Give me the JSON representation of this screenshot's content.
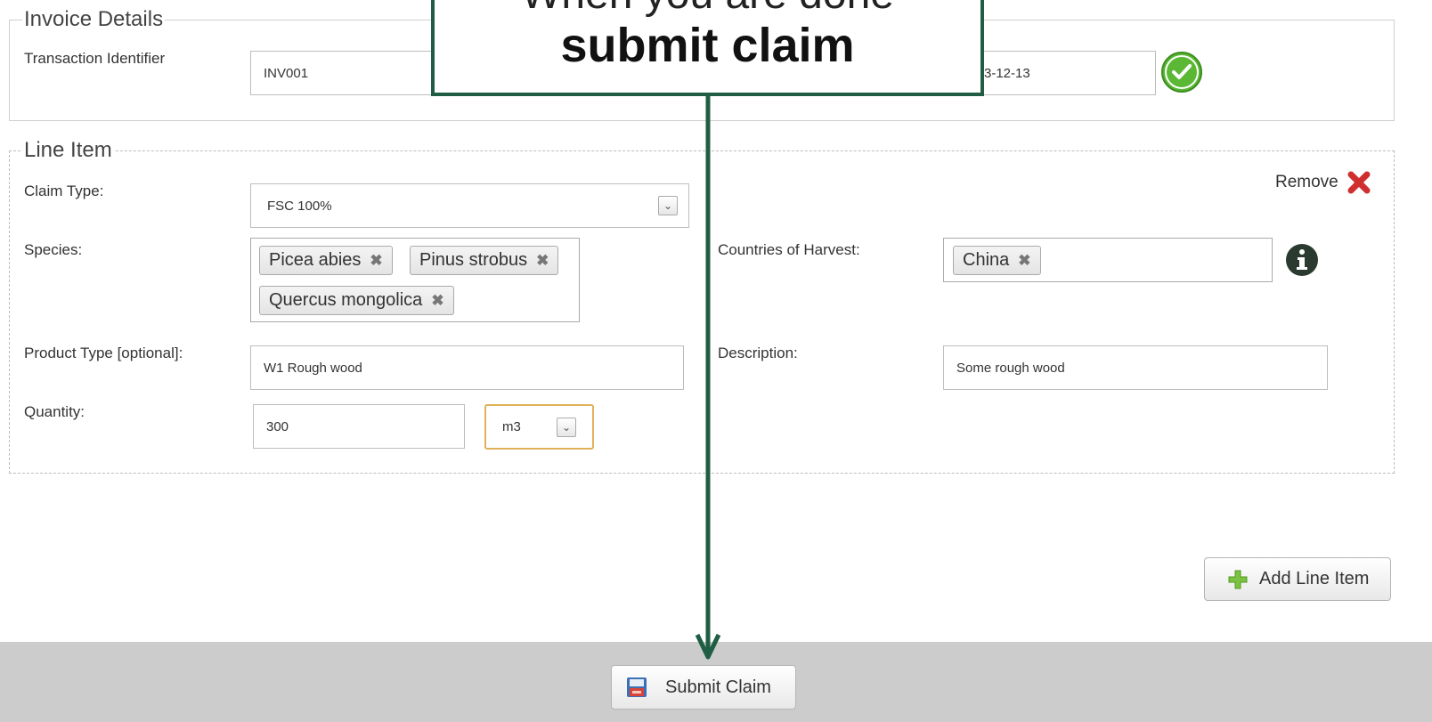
{
  "invoice": {
    "legend": "Invoice Details",
    "transaction_label": "Transaction Identifier",
    "transaction_value": "INV001",
    "date_value": "3-12-13"
  },
  "line_item": {
    "legend": "Line Item",
    "remove_label": "Remove",
    "claim_type_label": "Claim Type:",
    "claim_type_value": "FSC 100%",
    "species_label": "Species:",
    "species": [
      "Picea abies",
      "Pinus strobus",
      "Quercus mongolica"
    ],
    "countries_label": "Countries of Harvest:",
    "countries": [
      "China"
    ],
    "product_type_label": "Product Type [optional]:",
    "product_type_value": "W1 Rough wood",
    "description_label": "Description:",
    "description_value": "Some rough wood",
    "quantity_label": "Quantity:",
    "quantity_value": "300",
    "unit_value": "m3"
  },
  "actions": {
    "add_line_item": "Add Line Item",
    "submit_claim": "Submit Claim"
  },
  "callout": {
    "line1": "When you are done",
    "line2": "submit claim"
  },
  "colors": {
    "callout_border": "#1f5e45",
    "footer_bar": "#cccccc",
    "remove_x": "#d02f2f",
    "check_green": "#5bb834",
    "unit_focus_border": "#e0b15a"
  },
  "icons": {
    "check": "check-circle-icon",
    "remove": "remove-x-icon",
    "info": "info-icon",
    "add": "plus-icon",
    "submit": "save-icon"
  }
}
